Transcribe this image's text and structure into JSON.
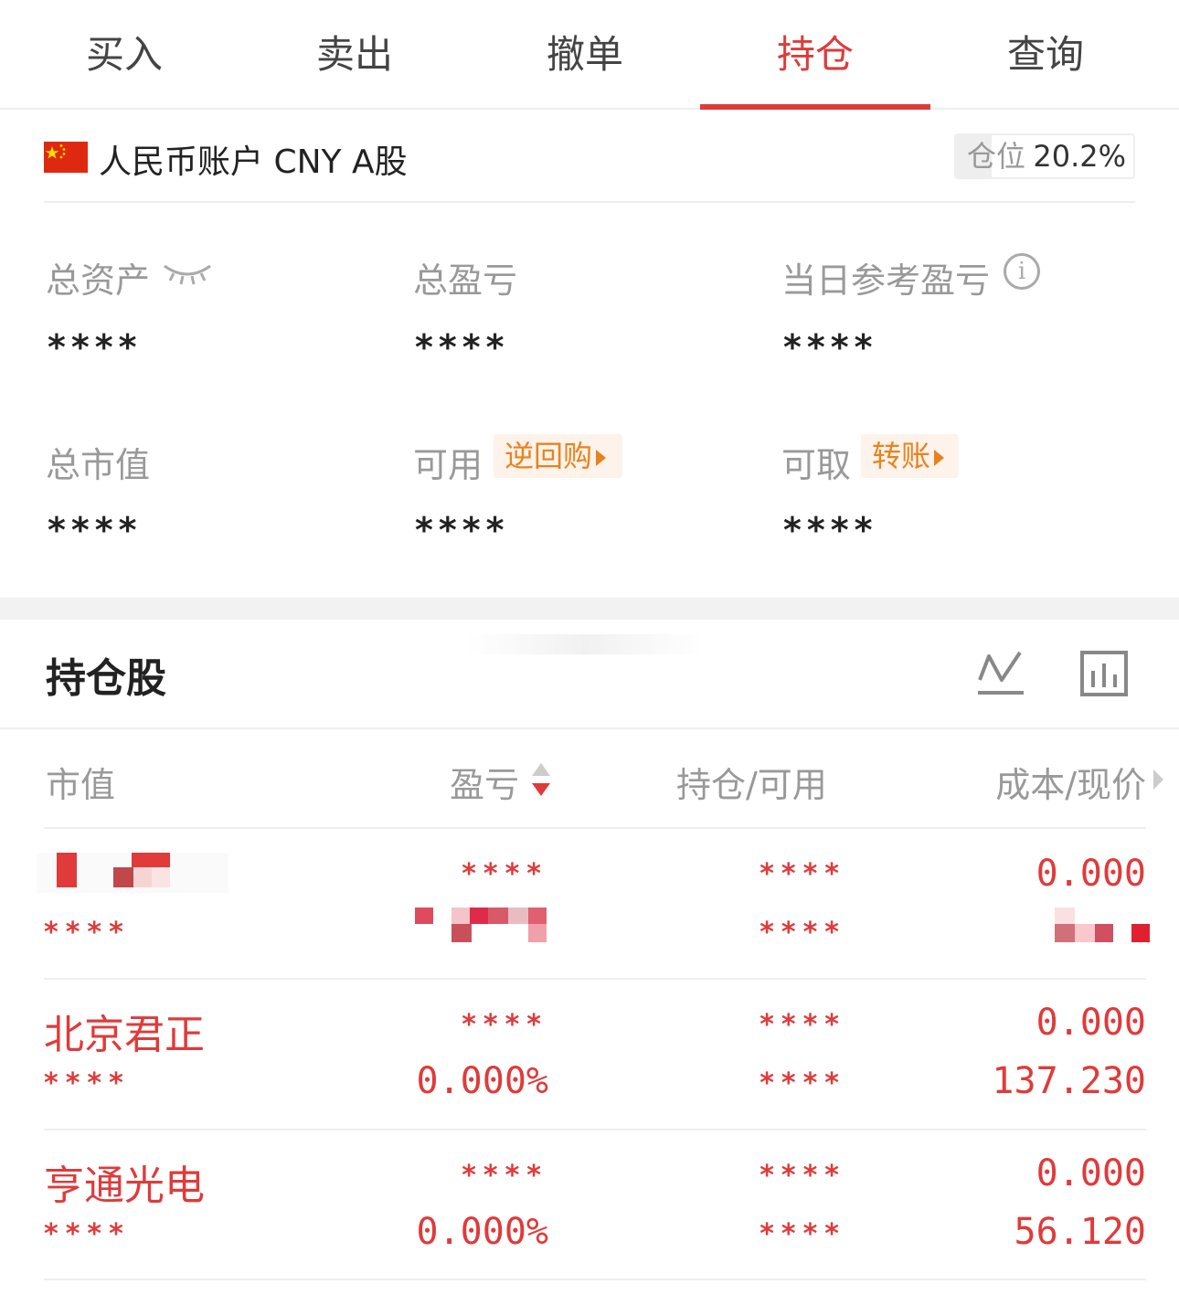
{
  "tabs": [
    {
      "label": "买入"
    },
    {
      "label": "卖出"
    },
    {
      "label": "撤单"
    },
    {
      "label": "持仓",
      "active": true
    },
    {
      "label": "查询"
    }
  ],
  "account": {
    "name": "人民币账户 CNY A股",
    "position_label": "仓位",
    "position_value": "20.2%",
    "position_ratio": 0.202
  },
  "summary": {
    "total_assets": {
      "label": "总资产",
      "value": "****"
    },
    "total_pnl": {
      "label": "总盈亏",
      "value": "****"
    },
    "daily_pnl": {
      "label": "当日参考盈亏",
      "value": "****"
    },
    "market_value": {
      "label": "总市值",
      "value": "****"
    },
    "available": {
      "label": "可用",
      "value": "****",
      "chip": "逆回购"
    },
    "withdrawable": {
      "label": "可取",
      "value": "****",
      "chip": "转账"
    }
  },
  "holdings": {
    "title": "持仓股",
    "columns": {
      "market_value": "市值",
      "pnl": "盈亏",
      "position": "持仓/可用",
      "cost": "成本/现价"
    },
    "rows": [
      {
        "name": "",
        "market_value": "****",
        "pnl": "****",
        "pnl_pct": "",
        "position": "****",
        "available": "****",
        "cost": "0.000",
        "price": ""
      },
      {
        "name": "北京君正",
        "market_value": "****",
        "pnl": "****",
        "pnl_pct": "0.000%",
        "position": "****",
        "available": "****",
        "cost": "0.000",
        "price": "137.230"
      },
      {
        "name": "亨通光电",
        "market_value": "****",
        "pnl": "****",
        "pnl_pct": "0.000%",
        "position": "****",
        "available": "****",
        "cost": "0.000",
        "price": "56.120"
      }
    ]
  },
  "colors": {
    "accent": "#e03a3a",
    "chip": "#e8821f",
    "muted": "#999999"
  },
  "icons": [
    "eye-closed-icon",
    "info-icon",
    "line-chart-icon",
    "bar-chart-icon",
    "sort-icon",
    "chevron-right-icon",
    "cn-flag-icon"
  ]
}
